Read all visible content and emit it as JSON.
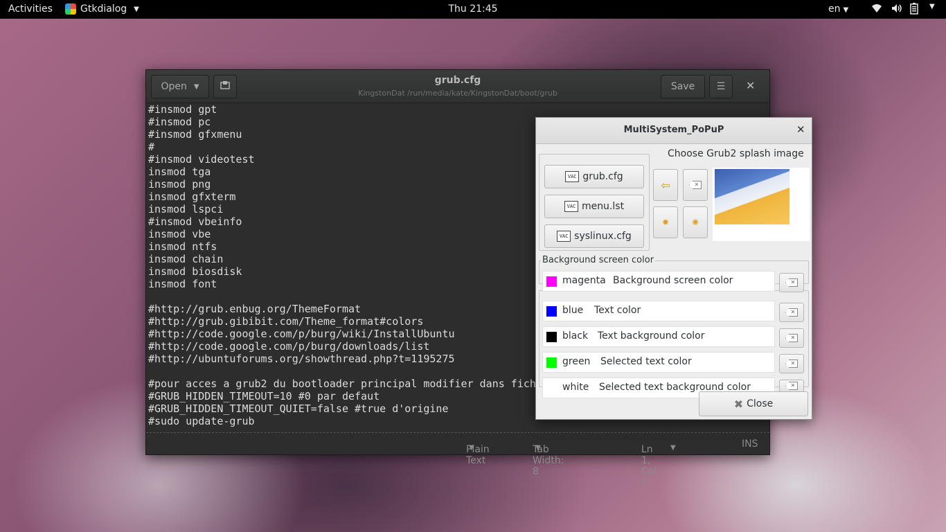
{
  "topbar": {
    "activities": "Activities",
    "app_name": "Gtkdialog",
    "clock": "Thu 21:45",
    "language": "en",
    "tray_icons": [
      "wifi-icon",
      "volume-icon",
      "battery-icon"
    ]
  },
  "gedit": {
    "open_label": "Open",
    "save_label": "Save",
    "title": "grub.cfg",
    "subtitle": "KingstonDat /run/media/kate/KingstonDat/boot/grub",
    "content": "#insmod gpt\n#insmod pc\n#insmod gfxmenu\n#\n#insmod videotest\ninsmod tga\ninsmod png\ninsmod gfxterm\ninsmod lspci\n#insmod vbeinfo\ninsmod vbe\ninsmod ntfs\ninsmod chain\ninsmod biosdisk\ninsmod font\n\n#http://grub.enbug.org/ThemeFormat\n#http://grub.gibibit.com/Theme_format#colors\n#http://code.google.com/p/burg/wiki/InstallUbuntu\n#http://code.google.com/p/burg/downloads/list\n#http://ubuntuforums.org/showthread.php?t=1195275\n\n#pour acces a grub2 du bootloader principal modifier dans fich\n#GRUB_HIDDEN_TIMEOUT=10 #0 par defaut\n#GRUB_HIDDEN_TIMEOUT_QUIET=false #true d'origine\n#sudo update-grub",
    "status": {
      "language": "Plain Text",
      "tab_width": "Tab Width: 8",
      "position": "Ln 1, Col 1",
      "mode": "INS"
    }
  },
  "popup": {
    "title": "MultiSystem_PoPuP",
    "cfg_buttons": [
      "grub.cfg",
      "menu.lst",
      "syslinux.cfg"
    ],
    "cfg_icon_text": "VAC",
    "splash_label": "Choose Grub2 splash image",
    "bg_legend": "Background screen color",
    "colors": [
      {
        "name": "magenta",
        "desc": "Background screen color",
        "swatch": "#ff00ff"
      },
      {
        "name": "blue",
        "desc": "Text color",
        "swatch": "#0000ff"
      },
      {
        "name": "black",
        "desc": "Text background color",
        "swatch": "#000000"
      },
      {
        "name": "green",
        "desc": "Selected text color",
        "swatch": "#00ff00"
      },
      {
        "name": "white",
        "desc": "Selected text background color",
        "swatch": "#ffffff"
      }
    ],
    "close_label": "Close"
  }
}
